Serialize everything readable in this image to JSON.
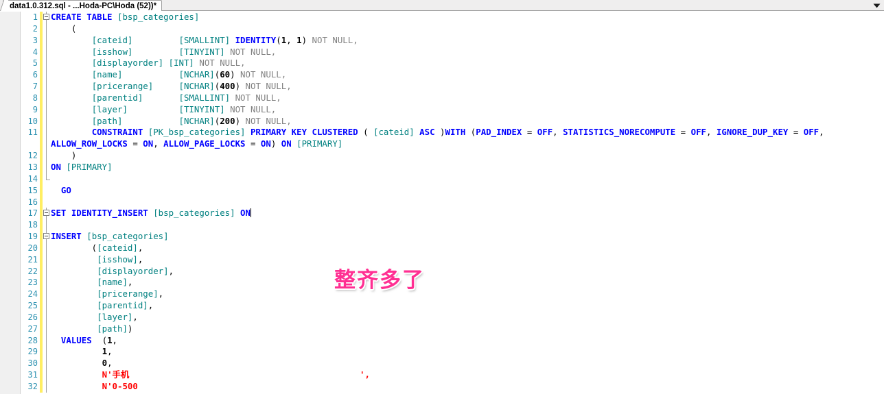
{
  "window": {
    "tab_title": "data1.0.312.sql - ...Hoda-PC\\Hoda (52))*",
    "tab_dropdown_icon": "chevron-down-icon"
  },
  "annotation": {
    "text": "整齐多了",
    "color": "#ff2f92"
  },
  "editor": {
    "colors": {
      "keyword": "#0000ff",
      "bracket_identifier": "#008080",
      "comment_gray": "#808080",
      "string": "#ff0000",
      "line_number": "#2b91af",
      "modified_bar": "#ffee62",
      "background": "#ffffff"
    },
    "caret_line": 17,
    "lines": [
      {
        "n": 1,
        "fold": "box",
        "tokens": [
          {
            "t": "CREATE TABLE ",
            "c": "kw"
          },
          {
            "t": "[bsp_categories]",
            "c": "br"
          }
        ]
      },
      {
        "n": 2,
        "fold": "line",
        "tokens": [
          {
            "t": "    (",
            "c": "pl"
          }
        ]
      },
      {
        "n": 3,
        "fold": "line",
        "tokens": [
          {
            "t": "        ",
            "c": "pl"
          },
          {
            "t": "[cateid]",
            "c": "br"
          },
          {
            "t": "         ",
            "c": "pl"
          },
          {
            "t": "[SMALLINT]",
            "c": "br"
          },
          {
            "t": " ",
            "c": "pl"
          },
          {
            "t": "IDENTITY",
            "c": "kw"
          },
          {
            "t": "(",
            "c": "pl"
          },
          {
            "t": "1",
            "c": "nm"
          },
          {
            "t": ", ",
            "c": "pl"
          },
          {
            "t": "1",
            "c": "nm"
          },
          {
            "t": ") ",
            "c": "pl"
          },
          {
            "t": "NOT NULL,",
            "c": "gy"
          }
        ]
      },
      {
        "n": 4,
        "fold": "line",
        "tokens": [
          {
            "t": "        ",
            "c": "pl"
          },
          {
            "t": "[isshow]",
            "c": "br"
          },
          {
            "t": "         ",
            "c": "pl"
          },
          {
            "t": "[TINYINT]",
            "c": "br"
          },
          {
            "t": " ",
            "c": "pl"
          },
          {
            "t": "NOT NULL,",
            "c": "gy"
          }
        ]
      },
      {
        "n": 5,
        "fold": "line",
        "tokens": [
          {
            "t": "        ",
            "c": "pl"
          },
          {
            "t": "[displayorder]",
            "c": "br"
          },
          {
            "t": " ",
            "c": "pl"
          },
          {
            "t": "[INT]",
            "c": "br"
          },
          {
            "t": " ",
            "c": "pl"
          },
          {
            "t": "NOT NULL,",
            "c": "gy"
          }
        ]
      },
      {
        "n": 6,
        "fold": "line",
        "tokens": [
          {
            "t": "        ",
            "c": "pl"
          },
          {
            "t": "[name]",
            "c": "br"
          },
          {
            "t": "           ",
            "c": "pl"
          },
          {
            "t": "[NCHAR]",
            "c": "br"
          },
          {
            "t": "(",
            "c": "pl"
          },
          {
            "t": "60",
            "c": "nm"
          },
          {
            "t": ") ",
            "c": "pl"
          },
          {
            "t": "NOT NULL,",
            "c": "gy"
          }
        ]
      },
      {
        "n": 7,
        "fold": "line",
        "tokens": [
          {
            "t": "        ",
            "c": "pl"
          },
          {
            "t": "[pricerange]",
            "c": "br"
          },
          {
            "t": "     ",
            "c": "pl"
          },
          {
            "t": "[NCHAR]",
            "c": "br"
          },
          {
            "t": "(",
            "c": "pl"
          },
          {
            "t": "400",
            "c": "nm"
          },
          {
            "t": ") ",
            "c": "pl"
          },
          {
            "t": "NOT NULL,",
            "c": "gy"
          }
        ]
      },
      {
        "n": 8,
        "fold": "line",
        "tokens": [
          {
            "t": "        ",
            "c": "pl"
          },
          {
            "t": "[parentid]",
            "c": "br"
          },
          {
            "t": "       ",
            "c": "pl"
          },
          {
            "t": "[SMALLINT]",
            "c": "br"
          },
          {
            "t": " ",
            "c": "pl"
          },
          {
            "t": "NOT NULL,",
            "c": "gy"
          }
        ]
      },
      {
        "n": 9,
        "fold": "line",
        "tokens": [
          {
            "t": "        ",
            "c": "pl"
          },
          {
            "t": "[layer]",
            "c": "br"
          },
          {
            "t": "          ",
            "c": "pl"
          },
          {
            "t": "[TINYINT]",
            "c": "br"
          },
          {
            "t": " ",
            "c": "pl"
          },
          {
            "t": "NOT NULL,",
            "c": "gy"
          }
        ]
      },
      {
        "n": 10,
        "fold": "line",
        "tokens": [
          {
            "t": "        ",
            "c": "pl"
          },
          {
            "t": "[path]",
            "c": "br"
          },
          {
            "t": "           ",
            "c": "pl"
          },
          {
            "t": "[NCHAR]",
            "c": "br"
          },
          {
            "t": "(",
            "c": "pl"
          },
          {
            "t": "200",
            "c": "nm"
          },
          {
            "t": ") ",
            "c": "pl"
          },
          {
            "t": "NOT NULL,",
            "c": "gy"
          }
        ]
      },
      {
        "n": 11,
        "fold": "line",
        "tokens": [
          {
            "t": "        ",
            "c": "pl"
          },
          {
            "t": "CONSTRAINT ",
            "c": "kw"
          },
          {
            "t": "[PK_bsp_categories]",
            "c": "br"
          },
          {
            "t": " ",
            "c": "pl"
          },
          {
            "t": "PRIMARY KEY CLUSTERED",
            "c": "kw"
          },
          {
            "t": " ( ",
            "c": "pl"
          },
          {
            "t": "[cateid]",
            "c": "br"
          },
          {
            "t": " ",
            "c": "pl"
          },
          {
            "t": "ASC",
            "c": "kw"
          },
          {
            "t": " )",
            "c": "pl"
          },
          {
            "t": "WITH",
            "c": "kw"
          },
          {
            "t": " (",
            "c": "pl"
          },
          {
            "t": "PAD_INDEX",
            "c": "kw"
          },
          {
            "t": " = ",
            "c": "pl"
          },
          {
            "t": "OFF",
            "c": "kw"
          },
          {
            "t": ", ",
            "c": "pl"
          },
          {
            "t": "STATISTICS_NORECOMPUTE",
            "c": "kw"
          },
          {
            "t": " = ",
            "c": "pl"
          },
          {
            "t": "OFF",
            "c": "kw"
          },
          {
            "t": ", ",
            "c": "pl"
          },
          {
            "t": "IGNORE_DUP_KEY",
            "c": "kw"
          },
          {
            "t": " = ",
            "c": "pl"
          },
          {
            "t": "OFF",
            "c": "kw"
          },
          {
            "t": ",",
            "c": "pl"
          }
        ]
      },
      {
        "n": "",
        "fold": "line",
        "wrapped": true,
        "tokens": [
          {
            "t": "ALLOW_ROW_LOCKS",
            "c": "kw"
          },
          {
            "t": " = ",
            "c": "pl"
          },
          {
            "t": "ON",
            "c": "kw"
          },
          {
            "t": ", ",
            "c": "pl"
          },
          {
            "t": "ALLOW_PAGE_LOCKS",
            "c": "kw"
          },
          {
            "t": " = ",
            "c": "pl"
          },
          {
            "t": "ON",
            "c": "kw"
          },
          {
            "t": ") ",
            "c": "pl"
          },
          {
            "t": "ON",
            "c": "kw"
          },
          {
            "t": " ",
            "c": "pl"
          },
          {
            "t": "[PRIMARY]",
            "c": "br"
          }
        ]
      },
      {
        "n": 12,
        "fold": "line",
        "tokens": [
          {
            "t": "    )",
            "c": "pl"
          }
        ]
      },
      {
        "n": 13,
        "fold": "end",
        "tokens": [
          {
            "t": "ON",
            "c": "kw"
          },
          {
            "t": " ",
            "c": "pl"
          },
          {
            "t": "[PRIMARY]",
            "c": "br"
          }
        ]
      },
      {
        "n": 14,
        "fold": "endcap",
        "tokens": []
      },
      {
        "n": 15,
        "fold": "none",
        "tokens": [
          {
            "t": "  ",
            "c": "pl"
          },
          {
            "t": "GO",
            "c": "kw"
          }
        ]
      },
      {
        "n": 16,
        "fold": "none",
        "tokens": []
      },
      {
        "n": 17,
        "fold": "box",
        "caret": true,
        "tokens": [
          {
            "t": "SET IDENTITY_INSERT",
            "c": "kw"
          },
          {
            "t": " ",
            "c": "pl"
          },
          {
            "t": "[bsp_categories]",
            "c": "br"
          },
          {
            "t": " ",
            "c": "pl"
          },
          {
            "t": "ON",
            "c": "kw"
          }
        ]
      },
      {
        "n": 18,
        "fold": "line",
        "tokens": []
      },
      {
        "n": 19,
        "fold": "box",
        "tokens": [
          {
            "t": "INSERT",
            "c": "kw"
          },
          {
            "t": " ",
            "c": "pl"
          },
          {
            "t": "[bsp_categories]",
            "c": "br"
          }
        ]
      },
      {
        "n": 20,
        "fold": "line",
        "tokens": [
          {
            "t": "        (",
            "c": "pl"
          },
          {
            "t": "[cateid]",
            "c": "br"
          },
          {
            "t": ",",
            "c": "pl"
          }
        ]
      },
      {
        "n": 21,
        "fold": "line",
        "tokens": [
          {
            "t": "         ",
            "c": "pl"
          },
          {
            "t": "[isshow]",
            "c": "br"
          },
          {
            "t": ",",
            "c": "pl"
          }
        ]
      },
      {
        "n": 22,
        "fold": "line",
        "tokens": [
          {
            "t": "         ",
            "c": "pl"
          },
          {
            "t": "[displayorder]",
            "c": "br"
          },
          {
            "t": ",",
            "c": "pl"
          }
        ]
      },
      {
        "n": 23,
        "fold": "line",
        "tokens": [
          {
            "t": "         ",
            "c": "pl"
          },
          {
            "t": "[name]",
            "c": "br"
          },
          {
            "t": ",",
            "c": "pl"
          }
        ]
      },
      {
        "n": 24,
        "fold": "line",
        "tokens": [
          {
            "t": "         ",
            "c": "pl"
          },
          {
            "t": "[pricerange]",
            "c": "br"
          },
          {
            "t": ",",
            "c": "pl"
          }
        ]
      },
      {
        "n": 25,
        "fold": "line",
        "tokens": [
          {
            "t": "         ",
            "c": "pl"
          },
          {
            "t": "[parentid]",
            "c": "br"
          },
          {
            "t": ",",
            "c": "pl"
          }
        ]
      },
      {
        "n": 26,
        "fold": "line",
        "tokens": [
          {
            "t": "         ",
            "c": "pl"
          },
          {
            "t": "[layer]",
            "c": "br"
          },
          {
            "t": ",",
            "c": "pl"
          }
        ]
      },
      {
        "n": 27,
        "fold": "line",
        "tokens": [
          {
            "t": "         ",
            "c": "pl"
          },
          {
            "t": "[path]",
            "c": "br"
          },
          {
            "t": ")",
            "c": "pl"
          }
        ]
      },
      {
        "n": 28,
        "fold": "line",
        "tokens": [
          {
            "t": "  ",
            "c": "pl"
          },
          {
            "t": "VALUES",
            "c": "kw"
          },
          {
            "t": "  (",
            "c": "pl"
          },
          {
            "t": "1",
            "c": "nm"
          },
          {
            "t": ",",
            "c": "pl"
          }
        ]
      },
      {
        "n": 29,
        "fold": "line",
        "tokens": [
          {
            "t": "          ",
            "c": "pl"
          },
          {
            "t": "1",
            "c": "nm"
          },
          {
            "t": ",",
            "c": "pl"
          }
        ]
      },
      {
        "n": 30,
        "fold": "line",
        "tokens": [
          {
            "t": "          ",
            "c": "pl"
          },
          {
            "t": "0",
            "c": "nm"
          },
          {
            "t": ",",
            "c": "pl"
          }
        ]
      },
      {
        "n": 31,
        "fold": "line",
        "tokens": [
          {
            "t": "          ",
            "c": "pl"
          },
          {
            "t": "N'手机                                             ',",
            "c": "st"
          }
        ]
      },
      {
        "n": 32,
        "fold": "line",
        "tokens": [
          {
            "t": "          ",
            "c": "pl"
          },
          {
            "t": "N'0-500",
            "c": "st"
          }
        ]
      }
    ]
  }
}
